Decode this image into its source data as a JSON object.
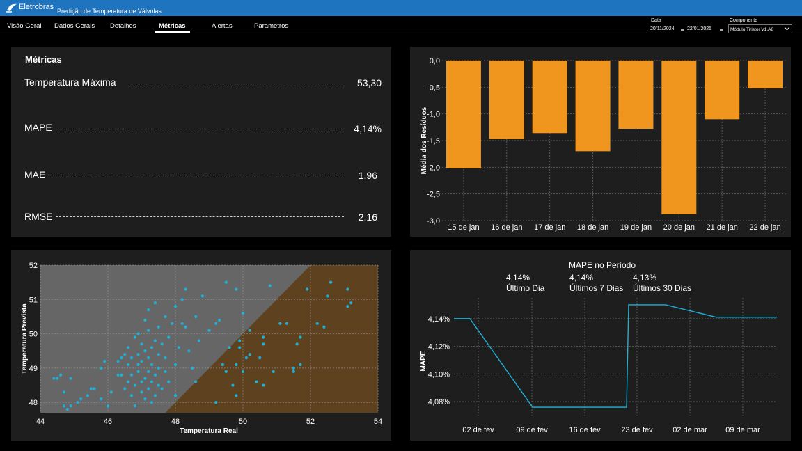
{
  "app": {
    "brand": "Eletrobras",
    "title": "Predição de Temperatura de Válvulas"
  },
  "nav": {
    "tabs": [
      {
        "label": "Visão Geral",
        "active": false
      },
      {
        "label": "Dados Gerais",
        "active": false
      },
      {
        "label": "Detalhes",
        "active": false
      },
      {
        "label": "Métricas",
        "active": true
      },
      {
        "label": "Alertas",
        "active": false
      },
      {
        "label": "Parametros",
        "active": false
      }
    ]
  },
  "filters": {
    "date_label": "Data",
    "date_start": "20/11/2024",
    "date_end": "22/01/2025",
    "component_label": "Componente",
    "component_value": "Módulo Tiristor V1.A8"
  },
  "metrics": {
    "title": "Métricas",
    "rows": [
      {
        "label": "Temperatura Máxima",
        "value": "53,30"
      },
      {
        "label": "MAPE",
        "value": "4,14%"
      },
      {
        "label": "MAE",
        "value": "1,96"
      },
      {
        "label": "RMSE",
        "value": "2,16"
      }
    ]
  },
  "colors": {
    "accent": "#1f74bf",
    "bar": "#f0961e",
    "scatter_point": "#1fb0d8",
    "line": "#1fb0d8",
    "upper_region": "#666666",
    "lower_region": "#5e4220"
  },
  "chart_data": [
    {
      "type": "bar",
      "ylabel": "Média dos Resíduos",
      "categories": [
        "15 de jan",
        "16 de jan",
        "17 de jan",
        "18 de jan",
        "19 de jan",
        "20 de jan",
        "21 de jan",
        "22 de jan"
      ],
      "values": [
        -2.02,
        -1.47,
        -1.36,
        -1.7,
        -1.28,
        -2.88,
        -1.1,
        -0.52
      ],
      "ylim": [
        -3.0,
        0.0
      ],
      "yticks": [
        "0,0",
        "-0,5",
        "-1,0",
        "-1,5",
        "-2,0",
        "-2,5",
        "-3,0"
      ],
      "grid": true
    },
    {
      "type": "scatter",
      "xlabel": "Temperatura Real",
      "ylabel": "Temperatura Prevista",
      "xlim": [
        44,
        54
      ],
      "ylim": [
        47.7,
        52
      ],
      "xticks": [
        "44",
        "46",
        "48",
        "50",
        "52",
        "54"
      ],
      "yticks": [
        "48",
        "49",
        "50",
        "51",
        "52"
      ],
      "grid": true,
      "points": [
        [
          44.4,
          48.7
        ],
        [
          44.5,
          48.7
        ],
        [
          44.6,
          48.8
        ],
        [
          44.7,
          48.3
        ],
        [
          44.7,
          47.9
        ],
        [
          44.8,
          47.8
        ],
        [
          44.9,
          47.9
        ],
        [
          44.9,
          48.7
        ],
        [
          45.1,
          48.0
        ],
        [
          45.2,
          48.1
        ],
        [
          45.4,
          48.2
        ],
        [
          45.5,
          48.4
        ],
        [
          45.6,
          48.4
        ],
        [
          45.8,
          48.1
        ],
        [
          45.8,
          49.0
        ],
        [
          45.9,
          49.2
        ],
        [
          46.0,
          47.9
        ],
        [
          46.1,
          48.3
        ],
        [
          46.3,
          48.8
        ],
        [
          46.3,
          49.2
        ],
        [
          46.4,
          49.3
        ],
        [
          46.4,
          48.8
        ],
        [
          46.5,
          48.4
        ],
        [
          46.5,
          49.4
        ],
        [
          46.6,
          49.1
        ],
        [
          46.6,
          48.6
        ],
        [
          46.6,
          49.6
        ],
        [
          46.7,
          48.2
        ],
        [
          46.7,
          48.8
        ],
        [
          46.7,
          49.3
        ],
        [
          46.8,
          48.5
        ],
        [
          46.8,
          49.9
        ],
        [
          46.8,
          47.9
        ],
        [
          46.9,
          48.9
        ],
        [
          46.9,
          49.1
        ],
        [
          46.9,
          49.4
        ],
        [
          46.9,
          50.0
        ],
        [
          47.0,
          48.3
        ],
        [
          47.0,
          48.6
        ],
        [
          47.0,
          49.2
        ],
        [
          47.0,
          49.7
        ],
        [
          47.1,
          48.1
        ],
        [
          47.1,
          48.7
        ],
        [
          47.1,
          49.5
        ],
        [
          47.1,
          50.4
        ],
        [
          47.2,
          48.4
        ],
        [
          47.2,
          48.9
        ],
        [
          47.2,
          49.3
        ],
        [
          47.2,
          50.1
        ],
        [
          47.2,
          50.7
        ],
        [
          47.3,
          48.0
        ],
        [
          47.3,
          48.6
        ],
        [
          47.3,
          49.1
        ],
        [
          47.3,
          49.6
        ],
        [
          47.4,
          48.2
        ],
        [
          47.4,
          48.8
        ],
        [
          47.4,
          49.8
        ],
        [
          47.4,
          50.9
        ],
        [
          47.5,
          48.5
        ],
        [
          47.5,
          49.0
        ],
        [
          47.5,
          49.4
        ],
        [
          47.5,
          50.2
        ],
        [
          47.6,
          48.4
        ],
        [
          47.6,
          49.7
        ],
        [
          47.7,
          48.9
        ],
        [
          47.7,
          49.3
        ],
        [
          47.7,
          50.5
        ],
        [
          47.8,
          48.6
        ],
        [
          47.8,
          49.9
        ],
        [
          47.9,
          50.3
        ],
        [
          48.0,
          48.2
        ],
        [
          48.0,
          49.1
        ],
        [
          48.0,
          50.8
        ],
        [
          48.1,
          49.6
        ],
        [
          48.2,
          50.3
        ],
        [
          48.2,
          51.0
        ],
        [
          48.3,
          50.2
        ],
        [
          48.3,
          51.3
        ],
        [
          48.4,
          49.5
        ],
        [
          48.5,
          49.0
        ],
        [
          48.6,
          50.5
        ],
        [
          48.6,
          48.6
        ],
        [
          48.7,
          49.8
        ],
        [
          48.8,
          51.1
        ],
        [
          49.0,
          50.1
        ],
        [
          49.2,
          50.3
        ],
        [
          49.2,
          48.0
        ],
        [
          49.3,
          50.4
        ],
        [
          49.4,
          49.1
        ],
        [
          49.5,
          48.9
        ],
        [
          49.5,
          51.5
        ],
        [
          49.6,
          49.6
        ],
        [
          49.7,
          48.5
        ],
        [
          49.8,
          49.1
        ],
        [
          49.8,
          51.3
        ],
        [
          49.8,
          48.2
        ],
        [
          49.9,
          49.8
        ],
        [
          49.9,
          49.6
        ],
        [
          50.0,
          48.9
        ],
        [
          50.0,
          50.6
        ],
        [
          50.1,
          49.3
        ],
        [
          50.2,
          49.4
        ],
        [
          50.2,
          50.1
        ],
        [
          50.4,
          48.6
        ],
        [
          50.5,
          49.3
        ],
        [
          50.6,
          49.7
        ],
        [
          50.6,
          49.9
        ],
        [
          50.6,
          48.5
        ],
        [
          50.8,
          51.4
        ],
        [
          50.9,
          48.9
        ],
        [
          51.1,
          50.3
        ],
        [
          51.3,
          50.3
        ],
        [
          51.5,
          49.0
        ],
        [
          51.5,
          48.9
        ],
        [
          51.6,
          49.7
        ],
        [
          51.7,
          49.1
        ],
        [
          51.7,
          49.9
        ],
        [
          51.9,
          51.3
        ],
        [
          52.2,
          50.3
        ],
        [
          52.4,
          50.2
        ],
        [
          52.5,
          51.1
        ],
        [
          52.6,
          51.5
        ],
        [
          53.1,
          50.8
        ],
        [
          53.1,
          51.3
        ],
        [
          53.2,
          50.9
        ]
      ]
    },
    {
      "type": "line",
      "title": "MAPE no Período",
      "ylabel": "MAPE",
      "ylim": [
        4.07,
        4.155
      ],
      "yticks": [
        "4,08%",
        "4,10%",
        "4,12%",
        "4,14%"
      ],
      "xticks": [
        "02 de fev",
        "09 de fev",
        "16 de fev",
        "23 de fev",
        "02 de mar",
        "09 de mar"
      ],
      "x": [
        0,
        1,
        2,
        3,
        4,
        5,
        6,
        7,
        8
      ],
      "values": [
        4.14,
        4.14,
        4.076,
        4.076,
        4.076,
        4.15,
        4.15,
        4.141,
        4.141
      ],
      "kpis": [
        {
          "value": "4,14%",
          "label": "Último Dia"
        },
        {
          "value": "4,14%",
          "label": "Últimos 7 Dias"
        },
        {
          "value": "4,13%",
          "label": "Últimos 30 Dias"
        }
      ],
      "grid": true
    }
  ]
}
